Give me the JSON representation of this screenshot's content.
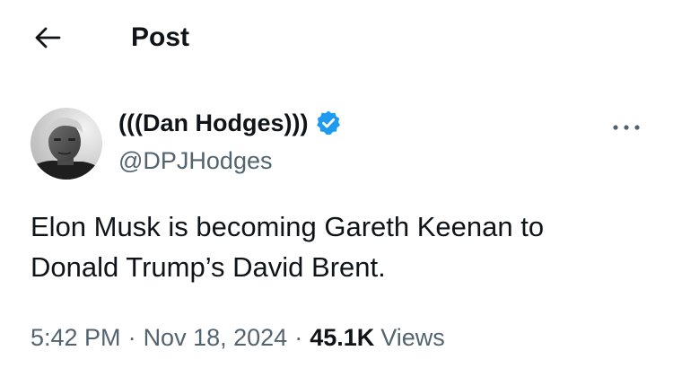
{
  "header": {
    "title": "Post",
    "back_icon": "arrow-left-icon"
  },
  "author": {
    "display_name": "(((Dan Hodges)))",
    "handle": "@DPJHodges",
    "verified_icon": "verified-badge-icon",
    "verified_color": "#1d9bf0",
    "more_icon": "more-horizontal-icon"
  },
  "post": {
    "text": "Elon Musk is becoming Gareth Keenan to\nDonald Trump’s David Brent."
  },
  "meta": {
    "time": "5:42 PM",
    "separator": "·",
    "date": "Nov 18, 2024",
    "views_count": "45.1K",
    "views_label": "Views"
  },
  "colors": {
    "text_primary": "#0f1419",
    "text_secondary": "#536471",
    "accent": "#1d9bf0"
  }
}
